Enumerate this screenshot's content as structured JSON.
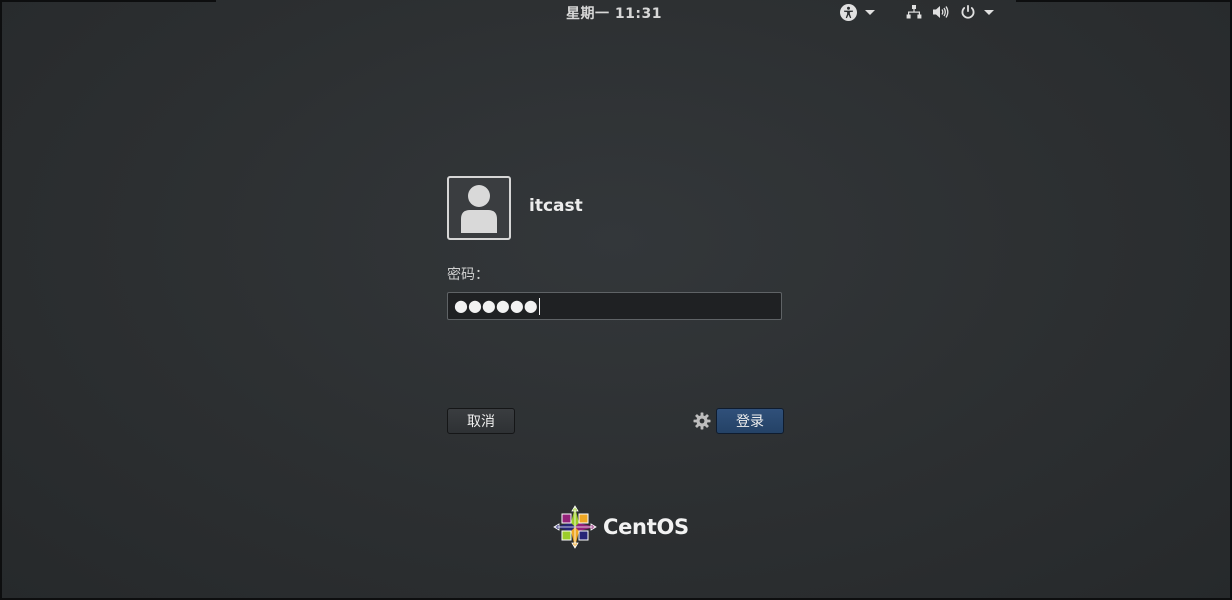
{
  "topbar": {
    "clock": "星期一 11:31",
    "icons": {
      "accessibility": "accessibility-icon",
      "network": "network-icon",
      "volume": "volume-icon",
      "power": "power-icon"
    }
  },
  "login": {
    "username": "itcast",
    "password_label": "密码：",
    "password_value": "●●●●●●",
    "cancel_label": "取消",
    "login_label": "登录"
  },
  "branding": {
    "logo_text": "CentOS"
  },
  "colors": {
    "background": "#2b2e30",
    "accent_button": "#244266",
    "text": "#ececec"
  }
}
